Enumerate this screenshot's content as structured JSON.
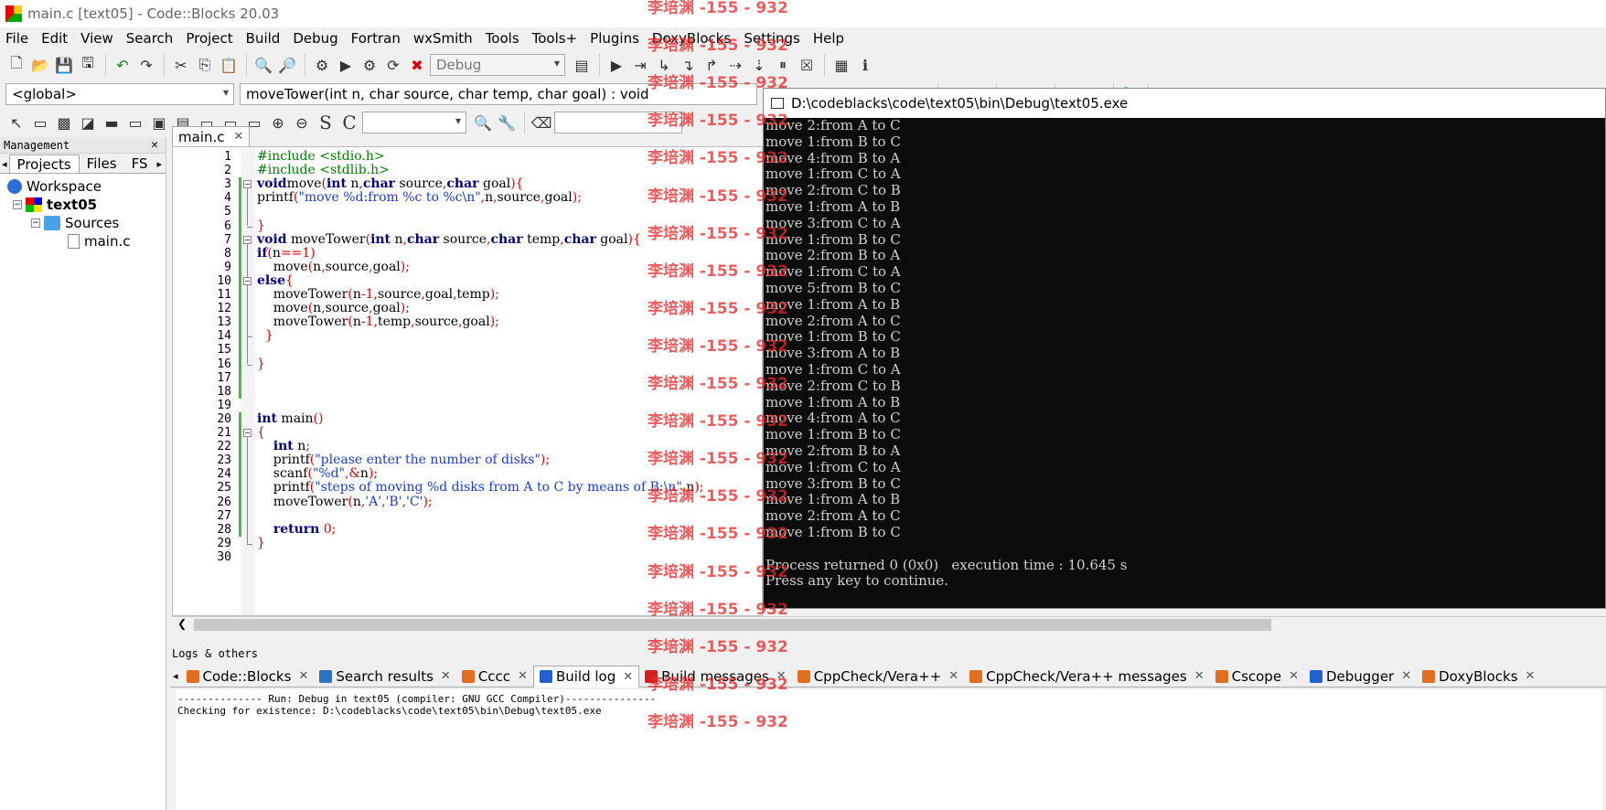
{
  "window": {
    "title": "main.c [text05] - Code::Blocks 20.03"
  },
  "menu": [
    "File",
    "Edit",
    "View",
    "Search",
    "Project",
    "Build",
    "Debug",
    "Fortran",
    "wxSmith",
    "Tools",
    "Tools+",
    "Plugins",
    "DoxyBlocks",
    "Settings",
    "Help"
  ],
  "toolbar": {
    "build_target": "Debug"
  },
  "code_bar": {
    "scope": "<global>",
    "function": "moveTower(int n, char source, char temp, char goal) : void"
  },
  "management": {
    "title": "Management",
    "tabs": [
      "Projects",
      "Files",
      "FS"
    ],
    "tree": {
      "workspace": "Workspace",
      "project": "text05",
      "folder": "Sources",
      "file": "main.c"
    }
  },
  "editor": {
    "tab": "main.c",
    "lines": [
      {
        "n": "1",
        "segs": [
          [
            "pp",
            "#include <stdio.h>"
          ]
        ]
      },
      {
        "n": "2",
        "segs": [
          [
            "pp",
            "#include <stdlib.h>"
          ]
        ]
      },
      {
        "n": "3",
        "segs": [
          [
            "kw",
            "void"
          ],
          [
            "",
            "move"
          ],
          [
            "op",
            "("
          ],
          [
            "kw",
            "int"
          ],
          [
            "",
            " n"
          ],
          [
            "op",
            ","
          ],
          [
            "kw",
            "char"
          ],
          [
            "",
            " source"
          ],
          [
            "op",
            ","
          ],
          [
            "kw",
            "char"
          ],
          [
            "",
            " goal"
          ],
          [
            "op",
            ")"
          ],
          [
            "op",
            "{"
          ]
        ]
      },
      {
        "n": "4",
        "segs": [
          [
            "",
            "printf"
          ],
          [
            "op",
            "("
          ],
          [
            "st",
            "\"move %d:from %c to %c\\n\""
          ],
          [
            "op",
            ","
          ],
          [
            "",
            "n"
          ],
          [
            "op",
            ","
          ],
          [
            "",
            "source"
          ],
          [
            "op",
            ","
          ],
          [
            "",
            "goal"
          ],
          [
            "op",
            ")"
          ],
          [
            "op",
            ";"
          ]
        ]
      },
      {
        "n": "5",
        "segs": []
      },
      {
        "n": "6",
        "segs": [
          [
            "op",
            "}"
          ]
        ]
      },
      {
        "n": "7",
        "segs": [
          [
            "kw",
            "void"
          ],
          [
            "",
            " moveTower"
          ],
          [
            "op",
            "("
          ],
          [
            "kw",
            "int"
          ],
          [
            "",
            " n"
          ],
          [
            "op",
            ","
          ],
          [
            "kw",
            "char"
          ],
          [
            "",
            " source"
          ],
          [
            "op",
            ","
          ],
          [
            "kw",
            "char"
          ],
          [
            "",
            " temp"
          ],
          [
            "op",
            ","
          ],
          [
            "kw",
            "char"
          ],
          [
            "",
            " goal"
          ],
          [
            "op",
            ")"
          ],
          [
            "op",
            "{"
          ]
        ]
      },
      {
        "n": "8",
        "segs": [
          [
            "kw",
            "if"
          ],
          [
            "op",
            "("
          ],
          [
            "",
            "n"
          ],
          [
            "op",
            "=="
          ],
          [
            "nu",
            "1"
          ],
          [
            "op",
            ")"
          ]
        ]
      },
      {
        "n": "9",
        "segs": [
          [
            "",
            "    move"
          ],
          [
            "op",
            "("
          ],
          [
            "",
            "n"
          ],
          [
            "op",
            ","
          ],
          [
            "",
            "source"
          ],
          [
            "op",
            ","
          ],
          [
            "",
            "goal"
          ],
          [
            "op",
            ")"
          ],
          [
            "op",
            ";"
          ]
        ]
      },
      {
        "n": "10",
        "segs": [
          [
            "kw",
            "else"
          ],
          [
            "op",
            "{"
          ]
        ]
      },
      {
        "n": "11",
        "segs": [
          [
            "",
            "    moveTower"
          ],
          [
            "op",
            "("
          ],
          [
            "",
            "n"
          ],
          [
            "op",
            "-"
          ],
          [
            "nu",
            "1"
          ],
          [
            "op",
            ","
          ],
          [
            "",
            "source"
          ],
          [
            "op",
            ","
          ],
          [
            "",
            "goal"
          ],
          [
            "op",
            ","
          ],
          [
            "",
            "temp"
          ],
          [
            "op",
            ")"
          ],
          [
            "op",
            ";"
          ]
        ]
      },
      {
        "n": "12",
        "segs": [
          [
            "",
            "    move"
          ],
          [
            "op",
            "("
          ],
          [
            "",
            "n"
          ],
          [
            "op",
            ","
          ],
          [
            "",
            "source"
          ],
          [
            "op",
            ","
          ],
          [
            "",
            "goal"
          ],
          [
            "op",
            ")"
          ],
          [
            "op",
            ";"
          ]
        ]
      },
      {
        "n": "13",
        "segs": [
          [
            "",
            "    moveTower"
          ],
          [
            "op",
            "("
          ],
          [
            "",
            "n"
          ],
          [
            "op",
            "-"
          ],
          [
            "nu",
            "1"
          ],
          [
            "op",
            ","
          ],
          [
            "",
            "temp"
          ],
          [
            "op",
            ","
          ],
          [
            "",
            "source"
          ],
          [
            "op",
            ","
          ],
          [
            "",
            "goal"
          ],
          [
            "op",
            ")"
          ],
          [
            "op",
            ";"
          ]
        ]
      },
      {
        "n": "14",
        "segs": [
          [
            "op",
            "  }"
          ]
        ]
      },
      {
        "n": "15",
        "segs": []
      },
      {
        "n": "16",
        "segs": [
          [
            "op",
            "}"
          ]
        ]
      },
      {
        "n": "17",
        "segs": []
      },
      {
        "n": "18",
        "segs": []
      },
      {
        "n": "19",
        "segs": []
      },
      {
        "n": "20",
        "segs": [
          [
            "kw",
            "int"
          ],
          [
            "",
            " main"
          ],
          [
            "op",
            "()"
          ]
        ]
      },
      {
        "n": "21",
        "segs": [
          [
            "op",
            "{"
          ]
        ]
      },
      {
        "n": "22",
        "segs": [
          [
            "",
            "    "
          ],
          [
            "kw",
            "int"
          ],
          [
            "",
            " n"
          ],
          [
            "op",
            ";"
          ]
        ]
      },
      {
        "n": "23",
        "segs": [
          [
            "",
            "    printf"
          ],
          [
            "op",
            "("
          ],
          [
            "st",
            "\"please enter the number of disks\""
          ],
          [
            "op",
            ")"
          ],
          [
            "op",
            ";"
          ]
        ]
      },
      {
        "n": "24",
        "segs": [
          [
            "",
            "    scanf"
          ],
          [
            "op",
            "("
          ],
          [
            "st",
            "\"%d\""
          ],
          [
            "op",
            ","
          ],
          [
            "op",
            "&"
          ],
          [
            "",
            "n"
          ],
          [
            "op",
            ")"
          ],
          [
            "op",
            ";"
          ]
        ]
      },
      {
        "n": "25",
        "segs": [
          [
            "",
            "    printf"
          ],
          [
            "op",
            "("
          ],
          [
            "st",
            "\"steps of moving %d disks from A to C by means of B:\\n\""
          ],
          [
            "op",
            ","
          ],
          [
            "",
            "n"
          ],
          [
            "op",
            ")"
          ],
          [
            "op",
            ";"
          ]
        ]
      },
      {
        "n": "26",
        "segs": [
          [
            "",
            "    moveTower"
          ],
          [
            "op",
            "("
          ],
          [
            "",
            "n"
          ],
          [
            "op",
            ","
          ],
          [
            "st",
            "'A'"
          ],
          [
            "op",
            ","
          ],
          [
            "st",
            "'B'"
          ],
          [
            "op",
            ","
          ],
          [
            "st",
            "'C'"
          ],
          [
            "op",
            ")"
          ],
          [
            "op",
            ";"
          ]
        ]
      },
      {
        "n": "27",
        "segs": []
      },
      {
        "n": "28",
        "segs": [
          [
            "",
            "    "
          ],
          [
            "kw",
            "return"
          ],
          [
            "",
            " "
          ],
          [
            "nu",
            "0"
          ],
          [
            "op",
            ";"
          ]
        ]
      },
      {
        "n": "29",
        "segs": [
          [
            "op",
            "}"
          ]
        ]
      },
      {
        "n": "30",
        "segs": []
      }
    ]
  },
  "console": {
    "title": "D:\\codeblacks\\code\\text05\\bin\\Debug\\text05.exe",
    "output": "move 2:from A to C\nmove 1:from B to C\nmove 4:from B to A\nmove 1:from C to A\nmove 2:from C to B\nmove 1:from A to B\nmove 3:from C to A\nmove 1:from B to C\nmove 2:from B to A\nmove 1:from C to A\nmove 5:from B to C\nmove 1:from A to B\nmove 2:from A to C\nmove 1:from B to C\nmove 3:from A to B\nmove 1:from C to A\nmove 2:from C to B\nmove 1:from A to B\nmove 4:from A to C\nmove 1:from B to C\nmove 2:from B to A\nmove 1:from C to A\nmove 3:from B to C\nmove 1:from A to B\nmove 2:from A to C\nmove 1:from B to C\n\nProcess returned 0 (0x0)   execution time : 10.645 s\nPress any key to continue."
  },
  "logs": {
    "title": "Logs & others",
    "tabs": [
      {
        "label": "Code::Blocks",
        "color": "#e07020"
      },
      {
        "label": "Search results",
        "color": "#3070c0"
      },
      {
        "label": "Cccc",
        "color": "#e07020"
      },
      {
        "label": "Build log",
        "color": "#2060d0",
        "active": true
      },
      {
        "label": "Build messages",
        "color": "#d02020"
      },
      {
        "label": "CppCheck/Vera++",
        "color": "#e07020"
      },
      {
        "label": "CppCheck/Vera++ messages",
        "color": "#e07020"
      },
      {
        "label": "Cscope",
        "color": "#e07020"
      },
      {
        "label": "Debugger",
        "color": "#2060d0"
      },
      {
        "label": "DoxyBlocks",
        "color": "#e07020"
      }
    ],
    "body": "-------------- Run: Debug in text05 (compiler: GNU GCC Compiler)---------------\nChecking for existence: D:\\codeblacks\\code\\text05\\bin\\Debug\\text05.exe"
  },
  "watermark": "李培渊 -155 - 932"
}
